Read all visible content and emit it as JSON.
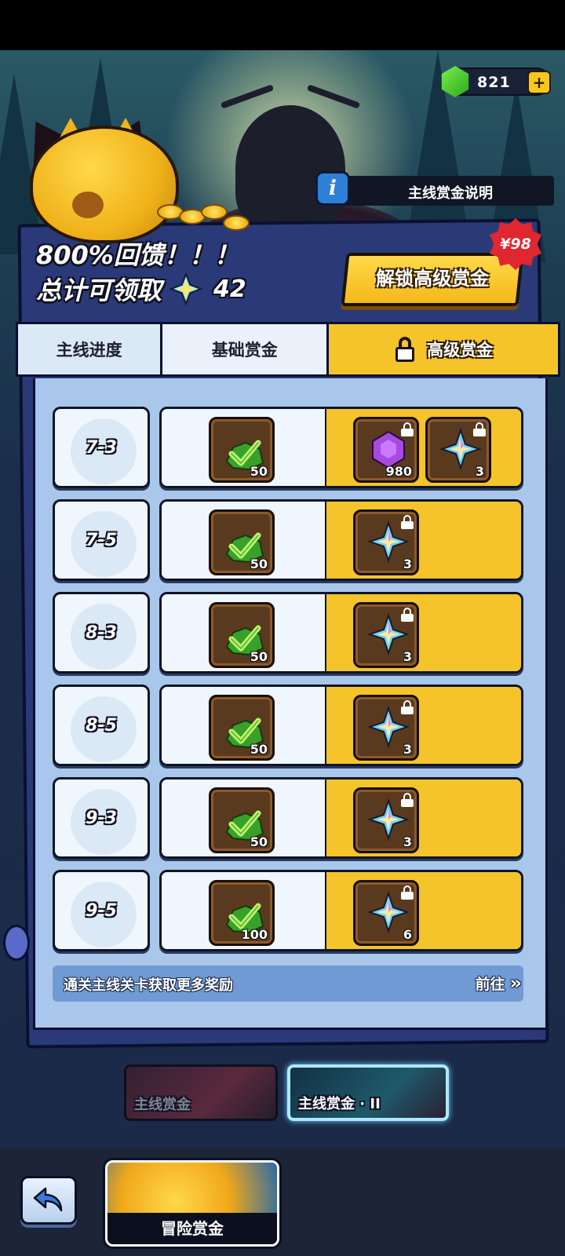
{
  "currency": {
    "gems": "821",
    "plus": "+"
  },
  "info_banner": {
    "icon": "i",
    "text": "主线赏金说明"
  },
  "headline": "800%回馈！！！",
  "total": {
    "label": "总计可领取",
    "value": "42"
  },
  "unlock_button": "解锁高级赏金",
  "price_badge": "¥98",
  "tabs": {
    "progress": "主线进度",
    "basic": "基础赏金",
    "premium": "高级赏金"
  },
  "rows": [
    {
      "stage": "7-3",
      "basic_qty": "50",
      "premium": [
        {
          "type": "purple-gem",
          "qty": "980"
        },
        {
          "type": "star-crystal",
          "qty": "3"
        }
      ]
    },
    {
      "stage": "7-5",
      "basic_qty": "50",
      "premium": [
        {
          "type": "star-crystal",
          "qty": "3"
        }
      ]
    },
    {
      "stage": "8-3",
      "basic_qty": "50",
      "premium": [
        {
          "type": "star-crystal",
          "qty": "3"
        }
      ]
    },
    {
      "stage": "8-5",
      "basic_qty": "50",
      "premium": [
        {
          "type": "star-crystal",
          "qty": "3"
        }
      ]
    },
    {
      "stage": "9-3",
      "basic_qty": "50",
      "premium": [
        {
          "type": "star-crystal",
          "qty": "3"
        }
      ]
    },
    {
      "stage": "9-5",
      "basic_qty": "100",
      "premium": [
        {
          "type": "star-crystal",
          "qty": "6"
        }
      ]
    }
  ],
  "footer": {
    "text": "通关主线关卡获取更多奖励",
    "go": "前往",
    "go_icon": "»"
  },
  "event_tabs": [
    {
      "label": "主线赏金"
    },
    {
      "label": "主线赏金 · II"
    }
  ],
  "bottom": {
    "adventure": "冒险赏金"
  },
  "colors": {
    "premium": "#f4c42a",
    "basic": "#f0f6fd",
    "panel": "#2a3a78",
    "list_bg": "#a9c7ea",
    "gem": "#3ec22a"
  }
}
